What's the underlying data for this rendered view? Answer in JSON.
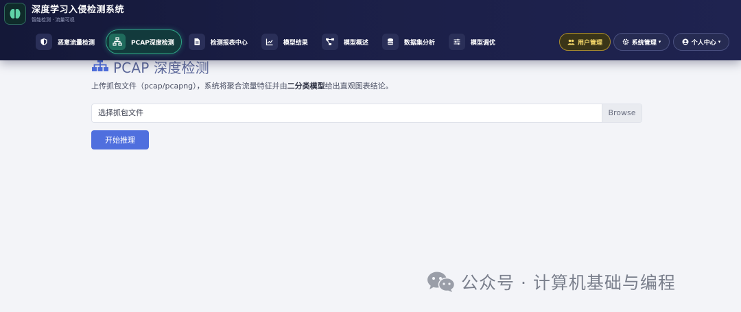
{
  "app": {
    "title": "深度学习入侵检测系统",
    "subtitle": "智能检测 · 流量可视"
  },
  "nav": [
    {
      "label": "恶意流量检测",
      "icon": "shield-icon"
    },
    {
      "label": "PCAP深度检测",
      "icon": "network-icon",
      "active": true
    },
    {
      "label": "检测报表中心",
      "icon": "file-icon"
    },
    {
      "label": "模型结果",
      "icon": "chart-line-icon"
    },
    {
      "label": "模型概述",
      "icon": "diagram-icon"
    },
    {
      "label": "数据集分析",
      "icon": "database-icon"
    },
    {
      "label": "模型调优",
      "icon": "sliders-icon"
    }
  ],
  "header_right": {
    "user_mgmt": "用户管理",
    "sys_mgmt": "系统管理",
    "personal": "个人中心"
  },
  "page": {
    "title": "PCAP 深度检测",
    "desc_prefix": "上传抓包文件（pcap/pcapng），系统将聚合流量特征并由",
    "desc_bold": "二分类模型",
    "desc_suffix": "给出直观图表结论。",
    "file_placeholder": "选择抓包文件",
    "browse": "Browse",
    "start": "开始推理"
  },
  "watermark": "公众号 · 计算机基础与编程",
  "colors": {
    "nav_bg": "#1b1f47",
    "active_accent": "#2fa587",
    "primary_button": "#4f6fde",
    "user_pill": "#f5d86a"
  }
}
